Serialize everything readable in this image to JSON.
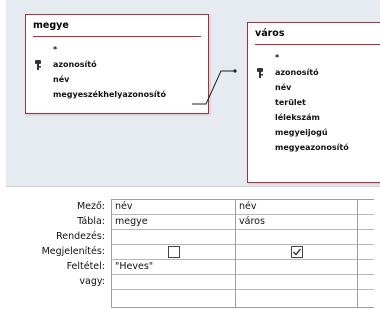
{
  "diagram": {
    "tables": [
      {
        "id": "megye",
        "title": "megye",
        "fields": [
          "*",
          "azonosító",
          "név",
          "megyeszékhelyazonosító"
        ],
        "key_field_index": 1
      },
      {
        "id": "varos",
        "title": "város",
        "fields": [
          "*",
          "azonosító",
          "név",
          "terület",
          "lélekszám",
          "megyeijogú",
          "megyeazonosító"
        ],
        "key_field_index": 1
      }
    ]
  },
  "grid": {
    "row_labels": [
      "Mező:",
      "Tábla:",
      "Rendezés:",
      "Megjelenítés:",
      "Feltétel:",
      "vagy:"
    ],
    "columns": [
      {
        "field": "név",
        "table": "megye",
        "sort": "",
        "show": false,
        "criteria": "\"Heves\"",
        "or": ""
      },
      {
        "field": "név",
        "table": "város",
        "sort": "",
        "show": true,
        "criteria": "",
        "or": ""
      },
      {
        "field": "",
        "table": "",
        "sort": "",
        "show": null,
        "criteria": "",
        "or": ""
      }
    ]
  }
}
